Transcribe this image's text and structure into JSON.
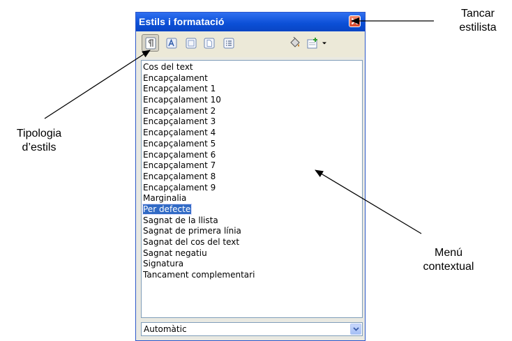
{
  "window": {
    "title": "Estils i formatació"
  },
  "toolbar": {
    "icons": [
      "paragraph-styles-icon",
      "character-styles-icon",
      "frame-styles-icon",
      "page-styles-icon",
      "list-styles-icon",
      "fill-format-icon",
      "new-style-icon",
      "chevron-down-icon"
    ]
  },
  "styles": {
    "items": [
      "Cos del text",
      "Encapçalament",
      "Encapçalament 1",
      "Encapçalament 10",
      "Encapçalament 2",
      "Encapçalament 3",
      "Encapçalament 4",
      "Encapçalament 5",
      "Encapçalament 6",
      "Encapçalament 7",
      "Encapçalament 8",
      "Encapçalament 9",
      "Marginalia",
      "Per defecte",
      "Sagnat de la llista",
      "Sagnat de primera línia",
      "Sagnat del cos del text",
      "Sagnat negatiu",
      "Signatura",
      "Tancament complementari"
    ],
    "selected": "Per defecte"
  },
  "filter": {
    "value": "Automàtic"
  },
  "annotations": {
    "close": {
      "line1": "Tancar",
      "line2": "estilista"
    },
    "types": {
      "line1": "Tipologia",
      "line2": "d’estils"
    },
    "menu": {
      "line1": "Menú",
      "line2": "contextual"
    }
  },
  "colors": {
    "titlebar": "#0b4fd6",
    "selection": "#316ac5",
    "close": "#d8472b"
  }
}
